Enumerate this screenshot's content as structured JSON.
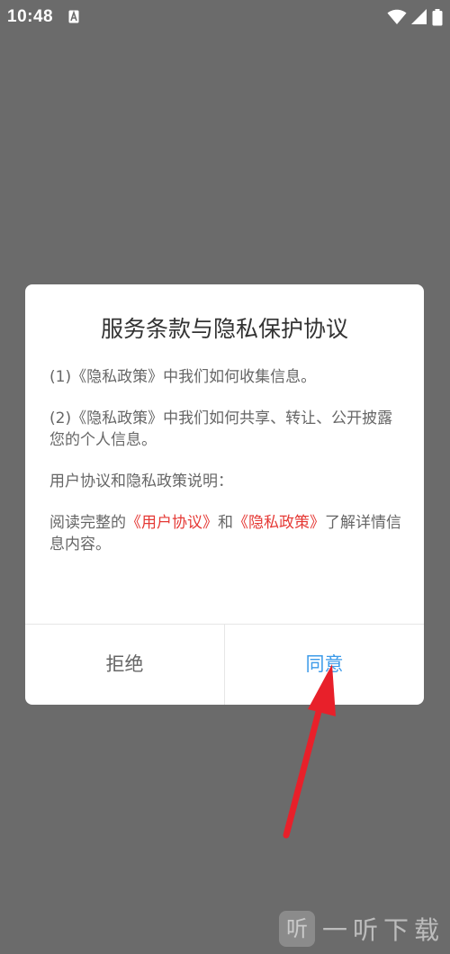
{
  "status_bar": {
    "time": "10:48",
    "notification_icon": "a-notification-icon",
    "icons": [
      "wifi-icon",
      "signal-icon",
      "battery-icon"
    ]
  },
  "dialog": {
    "title": "服务条款与隐私保护协议",
    "paragraphs": [
      "(1)《隐私政策》中我们如何收集信息。",
      "(2)《隐私政策》中我们如何共享、转让、公开披露您的个人信息。",
      "用户协议和隐私政策说明："
    ],
    "read_prefix": "阅读完整的",
    "user_agreement_link": "《用户协议》",
    "and_text": "和",
    "privacy_policy_link": "《隐私政策》",
    "read_suffix": "了解详情信息内容。",
    "reject_label": "拒绝",
    "agree_label": "同意"
  },
  "colors": {
    "overlay": "#6b6b6b",
    "link": "#e53935",
    "agree": "#3d9be9",
    "annotation_arrow": "#e8202a"
  },
  "watermark": {
    "logo_char": "听",
    "text": "一听下载"
  }
}
